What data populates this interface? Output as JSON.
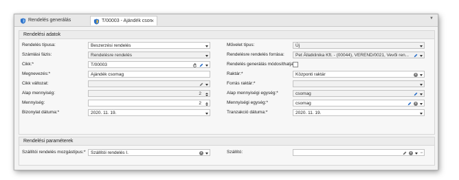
{
  "tabs": [
    {
      "label": "Rendelés generálás",
      "icon": "shield-icon"
    },
    {
      "label": "T/00003 - Ajándék cson",
      "icon": "shield-icon",
      "close": "×"
    }
  ],
  "section1": {
    "title": "Rendelési adatok",
    "left": [
      {
        "label": "Rendelés típusa:",
        "value": "Beszerzési rendelés"
      },
      {
        "label": "Számlási fázis:",
        "value": "Rendelésre rendelés"
      },
      {
        "label": "Cikk:*",
        "value": "T/00003"
      },
      {
        "label": "Megnevezés:*",
        "value": "Ajándék csomag"
      },
      {
        "label": "Cikk változat:",
        "value": ""
      },
      {
        "label": "Alap mennyiség:",
        "value": "2"
      },
      {
        "label": "Mennyiség:",
        "value": "2"
      },
      {
        "label": "Bizonylat dátuma:*",
        "value": "2020. 11. 19."
      }
    ],
    "right": [
      {
        "label": "Művelet típus:",
        "value": "Új"
      },
      {
        "label": "Rendelésre rendelés forrása:",
        "value": "Pet Állatklinika Kft. - (00044), VEREND/0021, Vevői ren..."
      },
      {
        "label": "Rendelés generálás módosíthatja",
        "value": ""
      },
      {
        "label": "Raktár:*",
        "value": "Központi raktár"
      },
      {
        "label": "Forrás raktár:*",
        "value": ""
      },
      {
        "label": "Alap mennyiségi egység:*",
        "value": "csomag"
      },
      {
        "label": "Mennyiségi egység:*",
        "value": "csomag"
      },
      {
        "label": "Tranzakció dátuma:*",
        "value": "2020. 11. 19."
      }
    ]
  },
  "section2": {
    "title": "Rendelési paraméterek",
    "left": {
      "label": "Szállítói rendelés mozgástípus:*",
      "value": "Szállítói rendelés I."
    },
    "right": {
      "label": "Szállító:",
      "value": ""
    }
  },
  "glyphs": {
    "clear": "×",
    "dots": "···"
  }
}
